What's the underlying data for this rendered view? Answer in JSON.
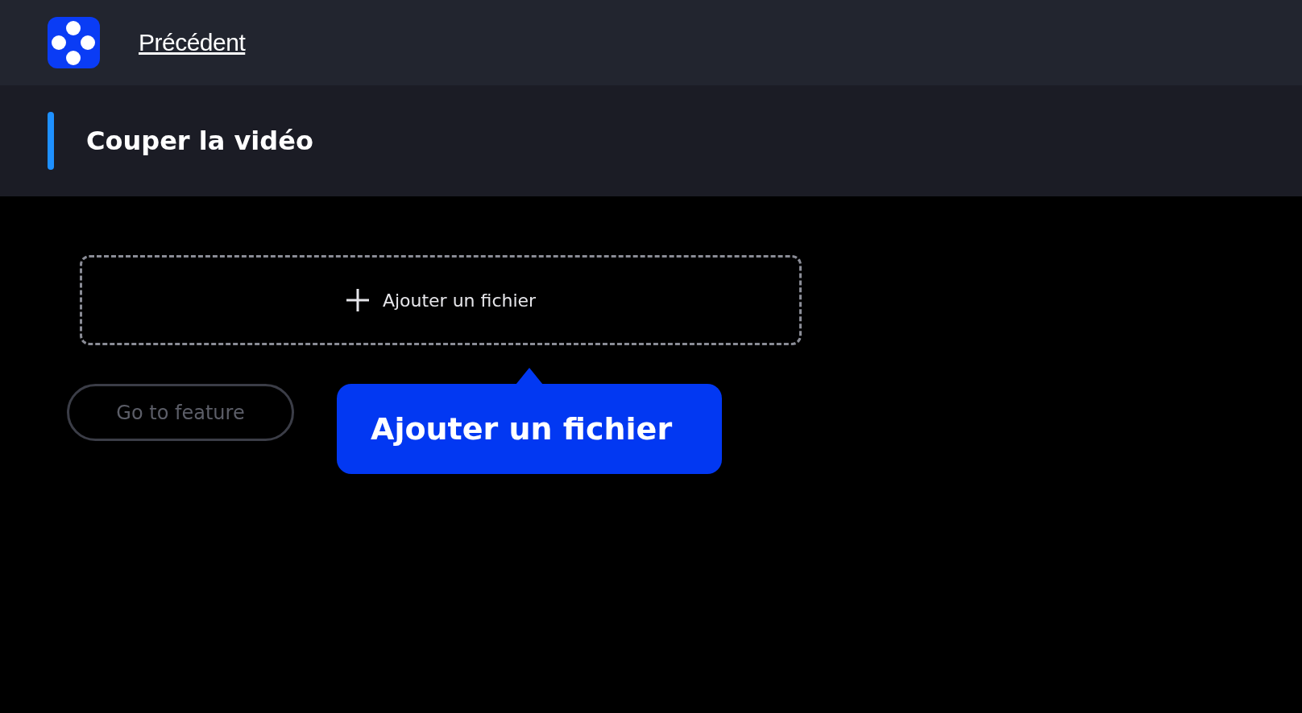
{
  "header": {
    "back_link": "Précédent"
  },
  "title": "Couper la vidéo",
  "upload": {
    "label": "Ajouter un fichier"
  },
  "feature_button": {
    "label": "Go to feature",
    "disabled": true
  },
  "tooltip": {
    "text": "Ajouter un fichier"
  }
}
